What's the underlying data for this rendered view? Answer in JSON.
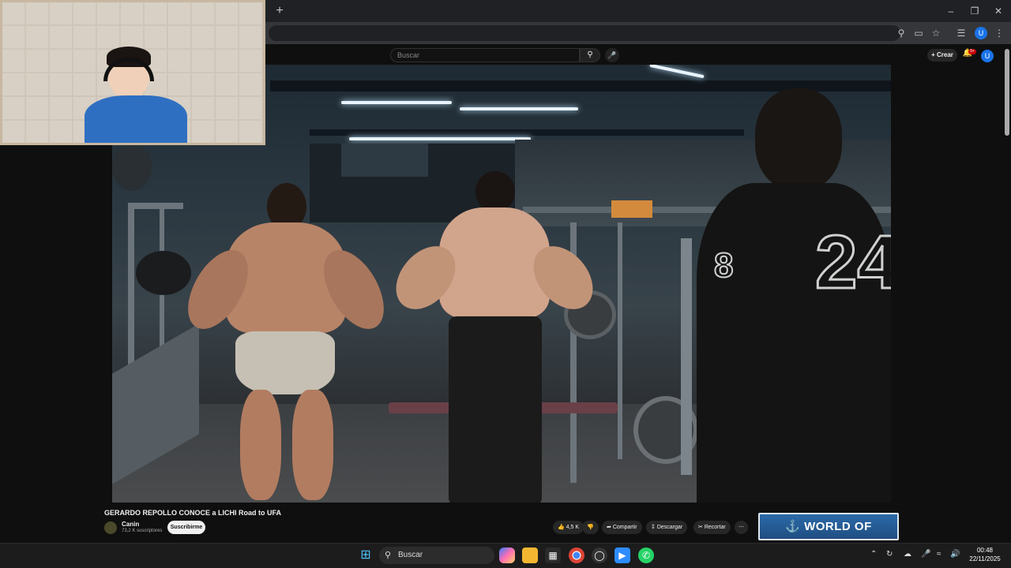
{
  "browser": {
    "new_tab_label": "+",
    "window_controls": [
      "minimize-icon",
      "restore-icon",
      "close-icon"
    ],
    "toolbar_icons": [
      "zoom-icon",
      "cast-icon",
      "bookmark-star-icon",
      "media-control-icon",
      "profile-avatar",
      "menu-kebab-icon"
    ],
    "profile_initial": "U"
  },
  "youtube": {
    "search": {
      "placeholder": "Buscar"
    },
    "create_label": "Crear",
    "notifications_badge": "9+",
    "profile_initial": "U",
    "video": {
      "title": "GERARDO REPOLLO CONOCE a LICHI Road to UFA",
      "channel": "Canin",
      "subscribers": "73,2 K suscriptores",
      "subscribe_label": "Suscribirme",
      "likes": "4,5 K",
      "share_label": "Compartir",
      "download_label": "Descargar",
      "clip_label": "Recortar",
      "jersey_number": "24",
      "sleeve_number": "8"
    },
    "ad_text": "WORLD OF WARSHIPS"
  },
  "taskbar": {
    "search_placeholder": "Buscar",
    "apps": [
      "windows-start-icon",
      "copilot-icon",
      "file-explorer-icon",
      "store-icon",
      "chrome-icon",
      "app-icon",
      "zoom-app-icon",
      "whatsapp-icon"
    ],
    "time": "00:48",
    "date": "22/11/2025"
  }
}
